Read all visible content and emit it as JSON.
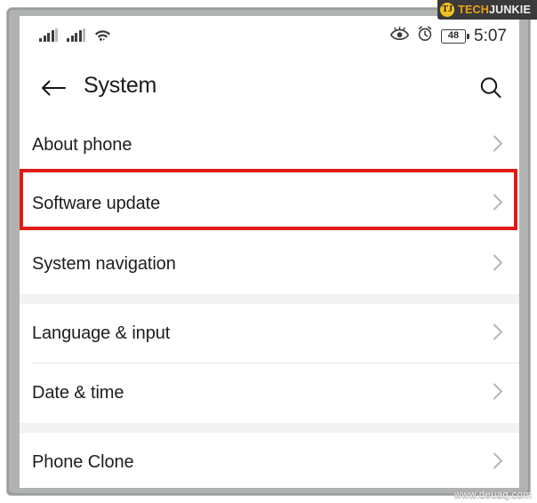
{
  "watermark": {
    "text": "www.deuaq.com"
  },
  "branding": {
    "logo_mark": "TJ",
    "logo_text_primary": "TECH",
    "logo_text_secondary": "JUNKIE",
    "logo_bg_color": "#3a3a3a",
    "logo_accent_color": "#e8a317",
    "logo_mark_color": "#f2c01e"
  },
  "status_bar": {
    "signal_1_icon": "cellular-signal-icon",
    "signal_2_icon": "cellular-signal-icon",
    "wifi_icon": "wifi-icon",
    "eye_comfort_icon": "eye-comfort-icon",
    "alarm_icon": "alarm-clock-icon",
    "battery_level": "48",
    "time": "5:07"
  },
  "app_bar": {
    "back_icon": "back-arrow-icon",
    "title": "System",
    "search_icon": "search-icon"
  },
  "highlight": {
    "color": "#e01b15",
    "target": "Software update"
  },
  "settings": {
    "groups": [
      {
        "items": [
          {
            "label": "About phone",
            "chevron": "chevron-right-icon",
            "divider": false
          },
          {
            "label": "Software update",
            "chevron": "chevron-right-icon",
            "divider": false,
            "highlighted": true
          },
          {
            "label": "System navigation",
            "chevron": "chevron-right-icon",
            "divider": false
          }
        ]
      },
      {
        "items": [
          {
            "label": "Language & input",
            "chevron": "chevron-right-icon",
            "divider": true
          },
          {
            "label": "Date & time",
            "chevron": "chevron-right-icon",
            "divider": false
          }
        ]
      },
      {
        "items": [
          {
            "label": "Phone Clone",
            "chevron": "chevron-right-icon",
            "divider": true
          }
        ]
      }
    ]
  }
}
